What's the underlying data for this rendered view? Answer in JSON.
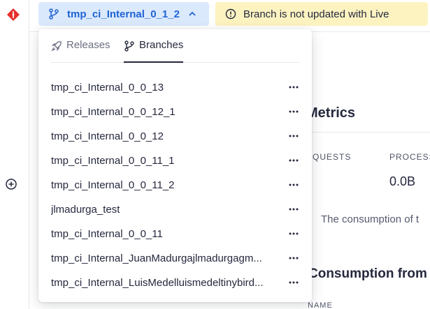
{
  "topbar": {
    "branch_label": "tmp_ci_Internal_0_1_2",
    "warning_text": "Branch is not updated with Live"
  },
  "dropdown": {
    "tabs": [
      {
        "label": "Releases",
        "icon": "rocket-icon"
      },
      {
        "label": "Branches",
        "icon": "branch-icon",
        "active": true
      }
    ],
    "branches": [
      "tmp_ci_Internal_0_0_13",
      "tmp_ci_Internal_0_0_12_1",
      "tmp_ci_Internal_0_0_12",
      "tmp_ci_Internal_0_0_11_1",
      "tmp_ci_Internal_0_0_11_2",
      "jlmadurga_test",
      "tmp_ci_Internal_0_0_11",
      "tmp_ci_Internal_JuanMadurgajlmadurgagm...",
      "tmp_ci_Internal_LuisMedelluismedeltinybird..."
    ]
  },
  "main": {
    "metrics_title": "Metrics",
    "requests_label": "EQUESTS",
    "processed_label": "PROCESS",
    "requests_value": ")",
    "processed_value": "0.0B",
    "consumption_note": "The consumption of t",
    "consumption_title": "Consumption from",
    "name_header": "NAME"
  },
  "colors": {
    "branch_button_bg": "#dbe9fd",
    "branch_button_text": "#1e63d4",
    "warning_bg": "#fdf3c1",
    "logo": "#e5302c"
  }
}
